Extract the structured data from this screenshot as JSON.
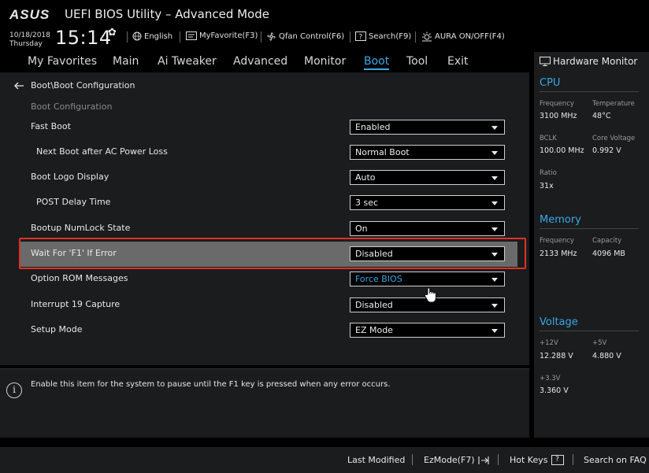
{
  "header": {
    "brand": "ASUS",
    "title": "UEFI BIOS Utility – Advanced Mode",
    "date": "10/18/2018",
    "weekday": "Thursday",
    "time": "15:14",
    "toolbar": [
      {
        "label": "English",
        "icon": "globe-icon"
      },
      {
        "label": "MyFavorite(F3)",
        "icon": "favorite-icon"
      },
      {
        "label": "Qfan Control(F6)",
        "icon": "fan-icon"
      },
      {
        "label": "Search(F9)",
        "icon": "search-icon"
      },
      {
        "label": "AURA ON/OFF(F4)",
        "icon": "aura-icon"
      }
    ]
  },
  "tabs": [
    "My Favorites",
    "Main",
    "Ai Tweaker",
    "Advanced",
    "Monitor",
    "Boot",
    "Tool",
    "Exit"
  ],
  "active_tab": "Boot",
  "breadcrumb": "Boot\\Boot Configuration",
  "section_header": "Boot Configuration",
  "settings": [
    {
      "label": "Fast Boot",
      "value": "Enabled"
    },
    {
      "label": "Next Boot after AC Power Loss",
      "value": "Normal Boot"
    },
    {
      "label": "Boot Logo Display",
      "value": "Auto"
    },
    {
      "label": "POST Delay Time",
      "value": "3 sec"
    },
    {
      "label": "Bootup NumLock State",
      "value": "On"
    },
    {
      "label": "Wait For 'F1' If Error",
      "value": "Disabled"
    },
    {
      "label": "Option ROM Messages",
      "value": "Force BIOS"
    },
    {
      "label": "Interrupt 19 Capture",
      "value": "Disabled"
    },
    {
      "label": "Setup Mode",
      "value": "EZ Mode"
    }
  ],
  "help_text": "Enable this item for the system to pause until the F1 key is pressed when any error occurs.",
  "hardware_monitor": {
    "title": "Hardware Monitor",
    "cpu": {
      "heading": "CPU",
      "frequency_label": "Frequency",
      "frequency": "3100 MHz",
      "temperature_label": "Temperature",
      "temperature": "48°C",
      "bclk_label": "BCLK",
      "bclk": "100.00 MHz",
      "core_voltage_label": "Core Voltage",
      "core_voltage": "0.992 V",
      "ratio_label": "Ratio",
      "ratio": "31x"
    },
    "memory": {
      "heading": "Memory",
      "frequency_label": "Frequency",
      "frequency": "2133 MHz",
      "capacity_label": "Capacity",
      "capacity": "4096 MB"
    },
    "voltage": {
      "heading": "Voltage",
      "v12_label": "+12V",
      "v12": "12.288 V",
      "v5_label": "+5V",
      "v5": "4.880 V",
      "v33_label": "+3.3V",
      "v33": "3.360 V"
    }
  },
  "footer": {
    "last_modified": "Last Modified",
    "ezmode": "EzMode(F7)",
    "hot_keys": "Hot Keys",
    "hot_keys_key": "?",
    "search_faq": "Search on FAQ"
  },
  "colors": {
    "accent": "#3aa8e6",
    "highlight_row": "#6a6a6a",
    "annotation_box": "#e03028"
  }
}
